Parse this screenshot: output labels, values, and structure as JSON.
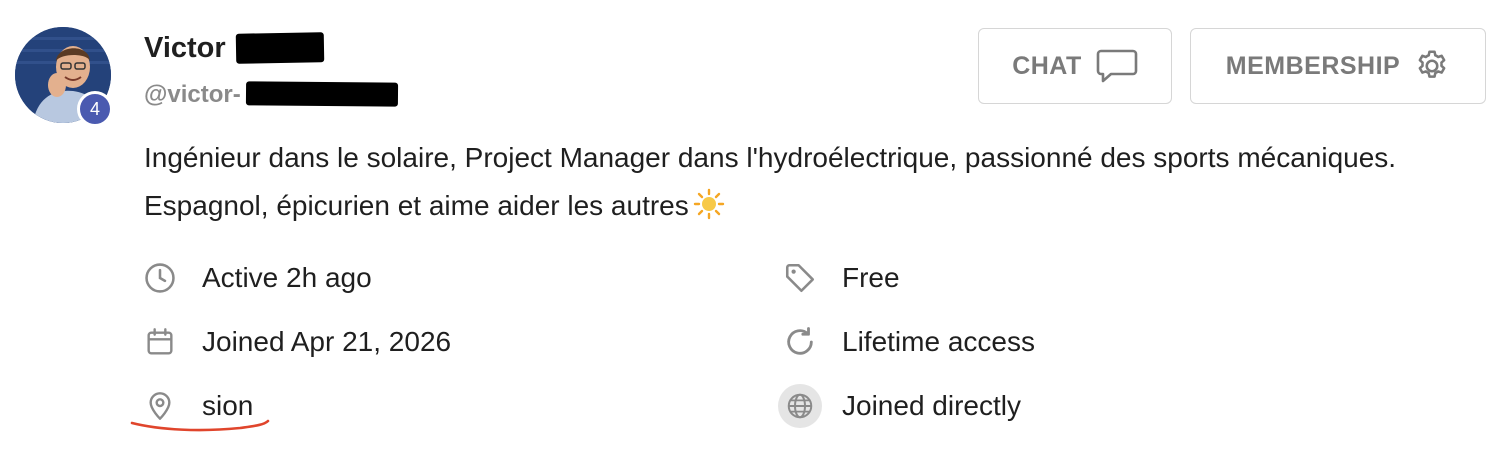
{
  "profile": {
    "name": "Victor",
    "handle": "@victor-",
    "level": "4",
    "bio": "Ingénieur dans le solaire, Project Manager dans l'hydroélectrique, passionné des sports mécaniques. Espagnol, épicurien et aime aider les autres"
  },
  "actions": {
    "chat_label": "CHAT",
    "membership_label": "MEMBERSHIP"
  },
  "meta_left": {
    "active": "Active 2h ago",
    "joined": "Joined Apr 21, 2026",
    "location": "sion"
  },
  "meta_right": {
    "plan": "Free",
    "access": "Lifetime access",
    "join_method": "Joined directly"
  },
  "icons": {
    "active": "clock-icon",
    "joined": "calendar-icon",
    "location": "map-pin-icon",
    "plan": "tag-icon",
    "access": "refresh-icon",
    "join_method": "globe-icon",
    "chat": "chat-bubble-icon",
    "membership": "gear-icon",
    "bio_emoji": "sun-icon"
  },
  "colors": {
    "badge": "#4a5ab0",
    "handle": "#8a8a8a",
    "button_text": "#7a7a7a",
    "icon": "#8a8a8a",
    "annotation": "#e0452c"
  }
}
